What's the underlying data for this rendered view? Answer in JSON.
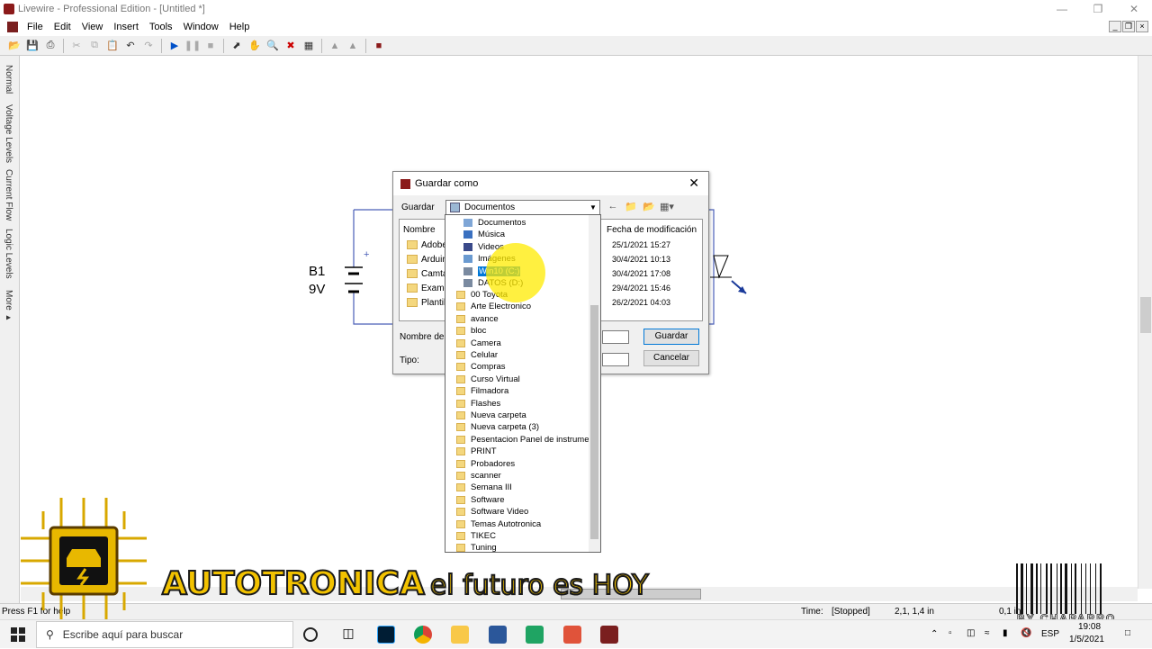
{
  "window": {
    "title": "Livewire - Professional Edition - [Untitled *]"
  },
  "menu": [
    "File",
    "Edit",
    "View",
    "Insert",
    "Tools",
    "Window",
    "Help"
  ],
  "left_tabs": [
    "Normal",
    "Voltage Levels",
    "Current Flow",
    "Logic Levels",
    "More ▸"
  ],
  "circuit": {
    "battery_name": "B1",
    "battery_value": "9V"
  },
  "dialog": {
    "title": "Guardar como",
    "save_in_label": "Guardar",
    "location": "Documentos",
    "col_name": "Nombre",
    "col_date": "Fecha de modificación",
    "files": [
      {
        "name": "Adobe",
        "date": "25/1/2021 15:27"
      },
      {
        "name": "Arduin",
        "date": "30/4/2021 10:13"
      },
      {
        "name": "Camta",
        "date": "30/4/2021 17:08"
      },
      {
        "name": "Exame",
        "date": "29/4/2021 15:46"
      },
      {
        "name": "Plantill",
        "date": "26/2/2021 04:03"
      }
    ],
    "filename_label": "Nombre de a",
    "type_label": "Tipo:",
    "save_button": "Guardar",
    "cancel_button": "Cancelar"
  },
  "dropdown": {
    "items": [
      "Documentos",
      "Música",
      "Videos",
      "Imágenes",
      "Win10 (C:)",
      "DATOS (D:)",
      "00 Toyota",
      "Arte Electronico",
      "avance",
      "bloc",
      "Camera",
      "Celular",
      "Compras",
      "Curso Virtual",
      "Filmadora",
      "Flashes",
      "Nueva carpeta",
      "Nueva carpeta (3)",
      "Pesentacion Panel de instrumento",
      "PRINT",
      "Probadores",
      "scanner",
      "Semana III",
      "Software",
      "Software Video",
      "Temas Autotronica",
      "TIKEC",
      "Tuning"
    ],
    "selected": "Win10 (C:)"
  },
  "statusbar": {
    "help": "Press F1 for help",
    "time_label": "Time:",
    "time_value": "[Stopped]",
    "coords": "2,1, 1,4 in",
    "zoom": "0,1 in"
  },
  "overlay": {
    "brand": "AUTOTRONICA",
    "tagline": "el futuro es HOY",
    "signature": "BY CHAPARRO"
  },
  "taskbar": {
    "search_placeholder": "Escribe aquí para buscar",
    "lang": "ESP",
    "time": "19:08",
    "date": "1/5/2021"
  }
}
